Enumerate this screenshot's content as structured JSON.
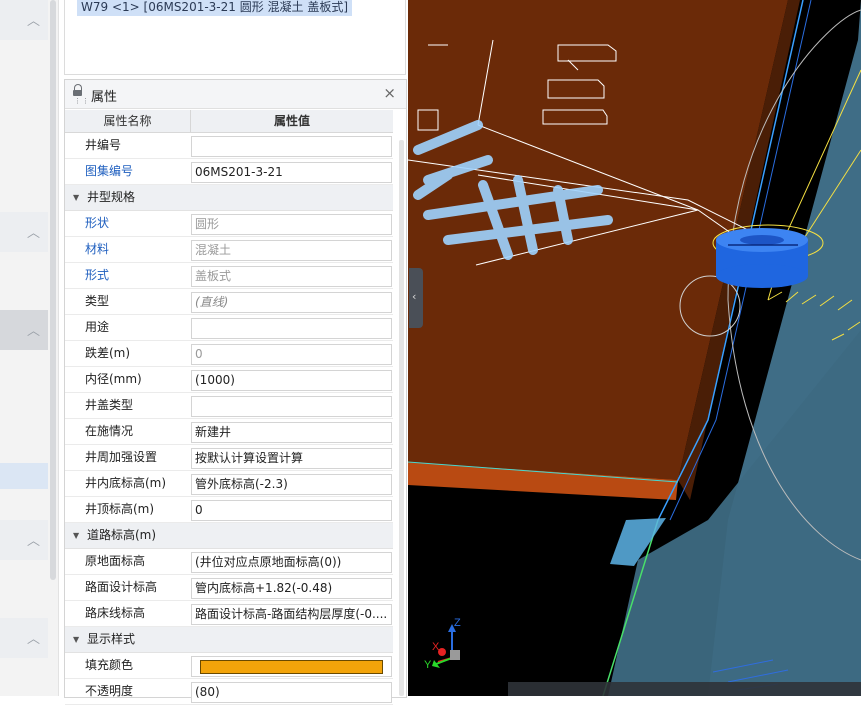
{
  "tree": {
    "selected_item": "W79 <1> [06MS201-3-21 圆形 混凝土 盖板式]"
  },
  "panel": {
    "title": "属性",
    "close_glyph": "×",
    "col_name": "属性名称",
    "col_value": "属性值"
  },
  "properties": [
    {
      "kind": "row",
      "name": "井编号",
      "value": "",
      "name_color": "normal",
      "value_style": "normal"
    },
    {
      "kind": "row",
      "name": "图集编号",
      "value": "06MS201-3-21",
      "name_color": "blue",
      "value_style": "normal"
    },
    {
      "kind": "cat",
      "name": "井型规格"
    },
    {
      "kind": "row",
      "name": "形状",
      "value": "圆形",
      "name_color": "blue",
      "value_style": "gray"
    },
    {
      "kind": "row",
      "name": "材料",
      "value": "混凝土",
      "name_color": "blue",
      "value_style": "gray"
    },
    {
      "kind": "row",
      "name": "形式",
      "value": "盖板式",
      "name_color": "blue",
      "value_style": "gray"
    },
    {
      "kind": "row",
      "name": "类型",
      "value": "(直线)",
      "name_color": "normal",
      "value_style": "italic"
    },
    {
      "kind": "row",
      "name": "用途",
      "value": "",
      "name_color": "normal",
      "value_style": "normal"
    },
    {
      "kind": "row",
      "name": "跌差(m)",
      "value": "0",
      "name_color": "normal",
      "value_style": "gray"
    },
    {
      "kind": "row",
      "name": "内径(mm)",
      "value": "(1000)",
      "name_color": "normal",
      "value_style": "normal"
    },
    {
      "kind": "row",
      "name": "井盖类型",
      "value": "",
      "name_color": "normal",
      "value_style": "normal"
    },
    {
      "kind": "row",
      "name": "在施情况",
      "value": "新建井",
      "name_color": "normal",
      "value_style": "normal"
    },
    {
      "kind": "row",
      "name": "井周加强设置",
      "value": "按默认计算设置计算",
      "name_color": "normal",
      "value_style": "normal"
    },
    {
      "kind": "row",
      "name": "井内底标高(m)",
      "value": "管外底标高(-2.3)",
      "name_color": "normal",
      "value_style": "normal"
    },
    {
      "kind": "row",
      "name": "井顶标高(m)",
      "value": "0",
      "name_color": "normal",
      "value_style": "normal"
    },
    {
      "kind": "cat",
      "name": "道路标高(m)"
    },
    {
      "kind": "row",
      "name": "原地面标高",
      "value": "(井位对应点原地面标高(0))",
      "name_color": "normal",
      "value_style": "normal"
    },
    {
      "kind": "row",
      "name": "路面设计标高",
      "value": "管内底标高+1.82(-0.48)",
      "name_color": "normal",
      "value_style": "normal"
    },
    {
      "kind": "row",
      "name": "路床线标高",
      "value": "路面设计标高-路面结构层厚度(-0....",
      "name_color": "normal",
      "value_style": "normal"
    },
    {
      "kind": "cat",
      "name": "显示样式"
    },
    {
      "kind": "swatch",
      "name": "填充颜色",
      "color": "#f3a40a"
    },
    {
      "kind": "row",
      "name": "不透明度",
      "value": "(80)",
      "name_color": "normal",
      "value_style": "normal"
    }
  ],
  "viewport": {
    "axis_x": "X",
    "axis_y": "Y",
    "axis_z": "Z",
    "collapse_glyph": "‹",
    "colors": {
      "ground": "#6b2a08",
      "ground_edge": "#b94a12",
      "road": "#3f6d86",
      "well": "#1f66e0",
      "text_lines": "#ffffff",
      "hatch": "#9fd3ff",
      "yellow_lines": "#f5e042"
    }
  }
}
